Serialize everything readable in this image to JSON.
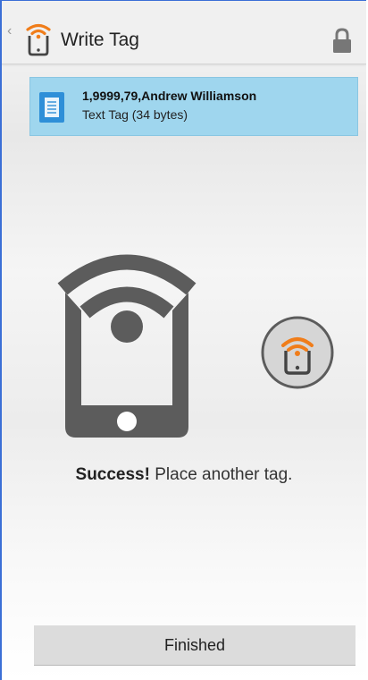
{
  "header": {
    "title": "Write Tag",
    "back_glyph": "‹",
    "app_icon": "nfc-phone-icon",
    "lock_icon": "lock-icon"
  },
  "record": {
    "title": "1,9999,79,Andrew Williamson",
    "subtitle": "Text Tag (34 bytes)",
    "icon": "document-icon"
  },
  "status": {
    "strong": "Success!",
    "message": " Place another tag."
  },
  "footer": {
    "finished_label": "Finished"
  },
  "colors": {
    "record_background": "#9fd6ee",
    "document_icon": "#2e8fd8",
    "phone_gray": "#5c5c5c",
    "nfc_accent": "#f07d1a",
    "button_background": "#dcdcdc"
  }
}
